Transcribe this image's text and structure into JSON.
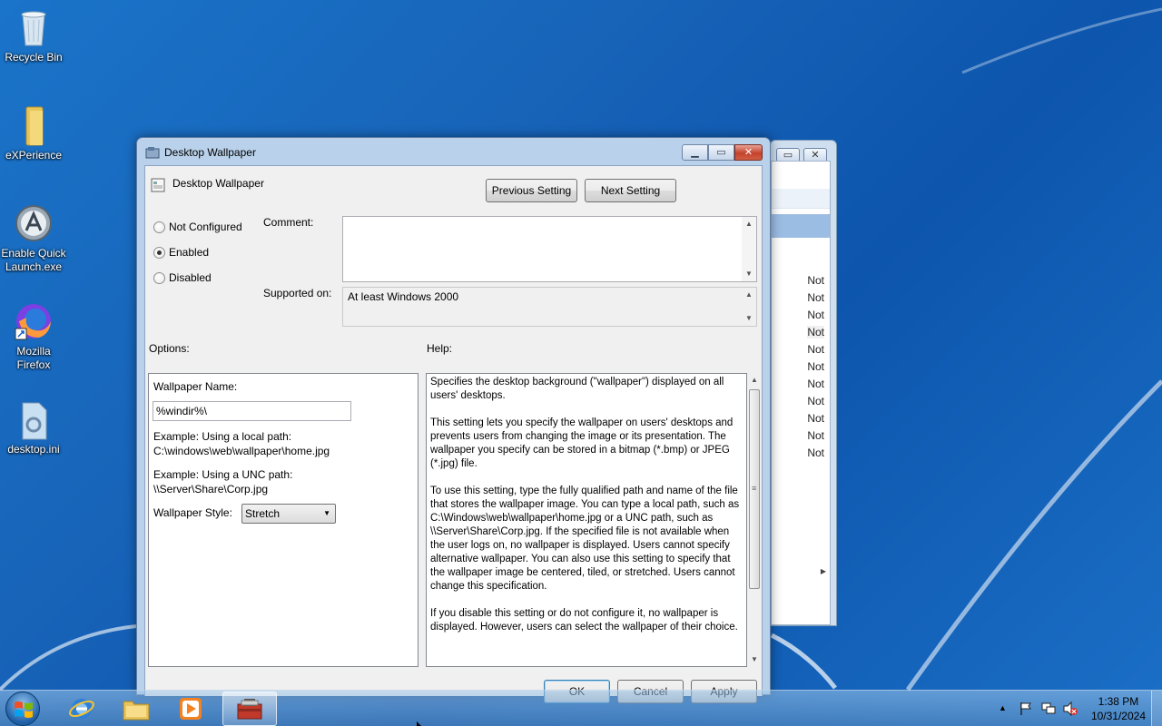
{
  "desktop": {
    "icons": [
      {
        "label": "Recycle Bin"
      },
      {
        "label": "eXPerience"
      },
      {
        "label": "Enable Quick Launch.exe"
      },
      {
        "label": "Mozilla Firefox"
      },
      {
        "label": "desktop.ini"
      }
    ]
  },
  "background_window": {
    "rows": [
      "Not",
      "Not",
      "Not",
      "Not",
      "Not",
      "Not",
      "Not",
      "Not",
      "Not",
      "Not",
      "Not"
    ]
  },
  "dialog": {
    "title": "Desktop Wallpaper",
    "setting_name": "Desktop Wallpaper",
    "prev_button": "Previous Setting",
    "next_button": "Next Setting",
    "radio": {
      "not_configured": "Not Configured",
      "enabled": "Enabled",
      "disabled": "Disabled",
      "selected": "Enabled"
    },
    "comment_label": "Comment:",
    "comment_value": "",
    "supported_label": "Supported on:",
    "supported_value": "At least Windows 2000",
    "options_label": "Options:",
    "help_label": "Help:",
    "options": {
      "wallpaper_name_label": "Wallpaper Name:",
      "wallpaper_name_value": "%windir%\\",
      "example_local_label": "Example: Using a local path:",
      "example_local_path": "C:\\windows\\web\\wallpaper\\home.jpg",
      "example_unc_label": "Example: Using a UNC path:",
      "example_unc_path": "\\\\Server\\Share\\Corp.jpg",
      "style_label": "Wallpaper Style:",
      "style_value": "Stretch"
    },
    "help": {
      "p1": "Specifies the desktop background (\"wallpaper\") displayed on all users' desktops.",
      "p2": "This setting lets you specify the wallpaper on users' desktops and prevents users from changing the image or its presentation. The wallpaper you specify can be stored in a bitmap (*.bmp) or JPEG (*.jpg) file.",
      "p3": "To use this setting, type the fully qualified path and name of the file that stores the wallpaper image. You can type a local path, such as C:\\Windows\\web\\wallpaper\\home.jpg or a UNC path, such as \\\\Server\\Share\\Corp.jpg. If the specified file is not available when the user logs on, no wallpaper is displayed. Users cannot specify alternative wallpaper. You can also use this setting to specify that the wallpaper image be centered, tiled, or stretched. Users cannot change this specification.",
      "p4": "If you disable this setting or do not configure it, no wallpaper is displayed. However, users can select the wallpaper of their choice."
    },
    "ok_button": "OK",
    "cancel_button": "Cancel",
    "apply_button": "Apply"
  },
  "taskbar": {
    "clock_time": "1:38 PM",
    "clock_date": "10/31/2024"
  }
}
